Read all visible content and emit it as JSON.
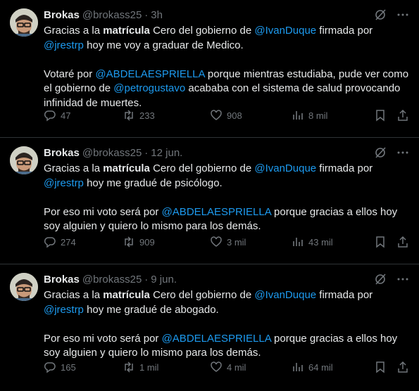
{
  "tweets": [
    {
      "name": "Brokas",
      "handle": "@brokass25",
      "sep": "·",
      "time": "3h",
      "line1_pre": "Gracias a la ",
      "line1_bold": "matrícula",
      "line1_mid": " Cero del gobierno de ",
      "line1_mention": "@IvanDuque",
      "line1_post": " firmada por",
      "line2_mention": "@jrestrp",
      "line2_post": " hoy me voy a graduar de Medico.",
      "p2_pre": "Votaré por ",
      "p2_mention1": "@ABDELAESPRIELLA",
      "p2_mid": " porque mientras estudiaba, pude ver como el gobierno de ",
      "p2_mention2": "@petrogustavo",
      "p2_post": " acababa con el sistema de salud provocando infinidad de muertes.",
      "replies": "47",
      "retweets": "233",
      "likes": "908",
      "views": "8 mil"
    },
    {
      "name": "Brokas",
      "handle": "@brokass25",
      "sep": "·",
      "time": "12 jun.",
      "line1_pre": "Gracias a la ",
      "line1_bold": "matrícula",
      "line1_mid": " Cero del gobierno de ",
      "line1_mention": "@IvanDuque",
      "line1_post": " firmada por",
      "line2_mention": "@jrestrp",
      "line2_post": " hoy me gradué de psicólogo.",
      "p2_pre": "Por eso mi voto será por ",
      "p2_mention1": "@ABDELAESPRIELLA",
      "p2_mid": " porque gracias a ellos hoy soy alguien y quiero lo mismo para los demás.",
      "replies": "274",
      "retweets": "909",
      "likes": "3 mil",
      "views": "43 mil"
    },
    {
      "name": "Brokas",
      "handle": "@brokass25",
      "sep": "·",
      "time": "9 jun.",
      "line1_pre": "Gracias a la ",
      "line1_bold": "matrícula",
      "line1_mid": " Cero del gobierno de ",
      "line1_mention": "@IvanDuque",
      "line1_post": " firmada por",
      "line2_mention": "@jrestrp",
      "line2_post": " hoy me gradué de abogado.",
      "p2_pre": "Por eso mi voto será por ",
      "p2_mention1": "@ABDELAESPRIELLA",
      "p2_mid": " porque gracias a ellos hoy soy alguien y quiero lo mismo para los demás.",
      "replies": "165",
      "retweets": "1 mil",
      "likes": "4 mil",
      "views": "64 mil"
    }
  ],
  "icons": {
    "grok": "grok-icon",
    "more": "more-icon",
    "reply": "reply-icon",
    "retweet": "retweet-icon",
    "like": "like-icon",
    "views": "views-icon",
    "bookmark": "bookmark-icon",
    "share": "share-icon"
  },
  "colors": {
    "background": "#000000",
    "text": "#e7e9ea",
    "muted": "#71767b",
    "mention": "#1d9bf0",
    "divider": "#2f3336"
  }
}
